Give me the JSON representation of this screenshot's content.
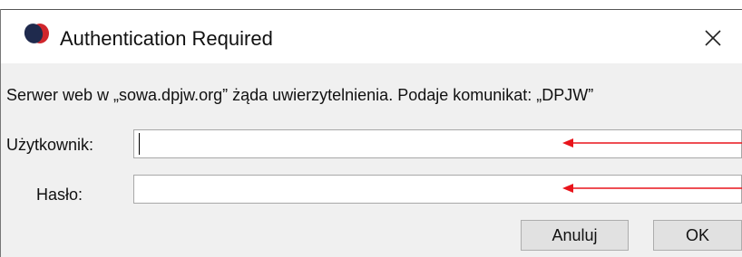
{
  "dialog": {
    "title": "Authentication Required",
    "app_icon": "app-icon",
    "close_icon": "close-icon",
    "message": "Serwer web w „sowa.dpjw.org” żąda uwierzytelnienia. Podaje komunikat: „DPJW”",
    "username": {
      "label": "Użytkownik:",
      "value": "",
      "placeholder": ""
    },
    "password": {
      "label": "Hasło:",
      "value": "",
      "placeholder": ""
    },
    "buttons": {
      "cancel_label": "Anuluj",
      "ok_label": "OK"
    },
    "annotation_color": "#e8141b"
  }
}
